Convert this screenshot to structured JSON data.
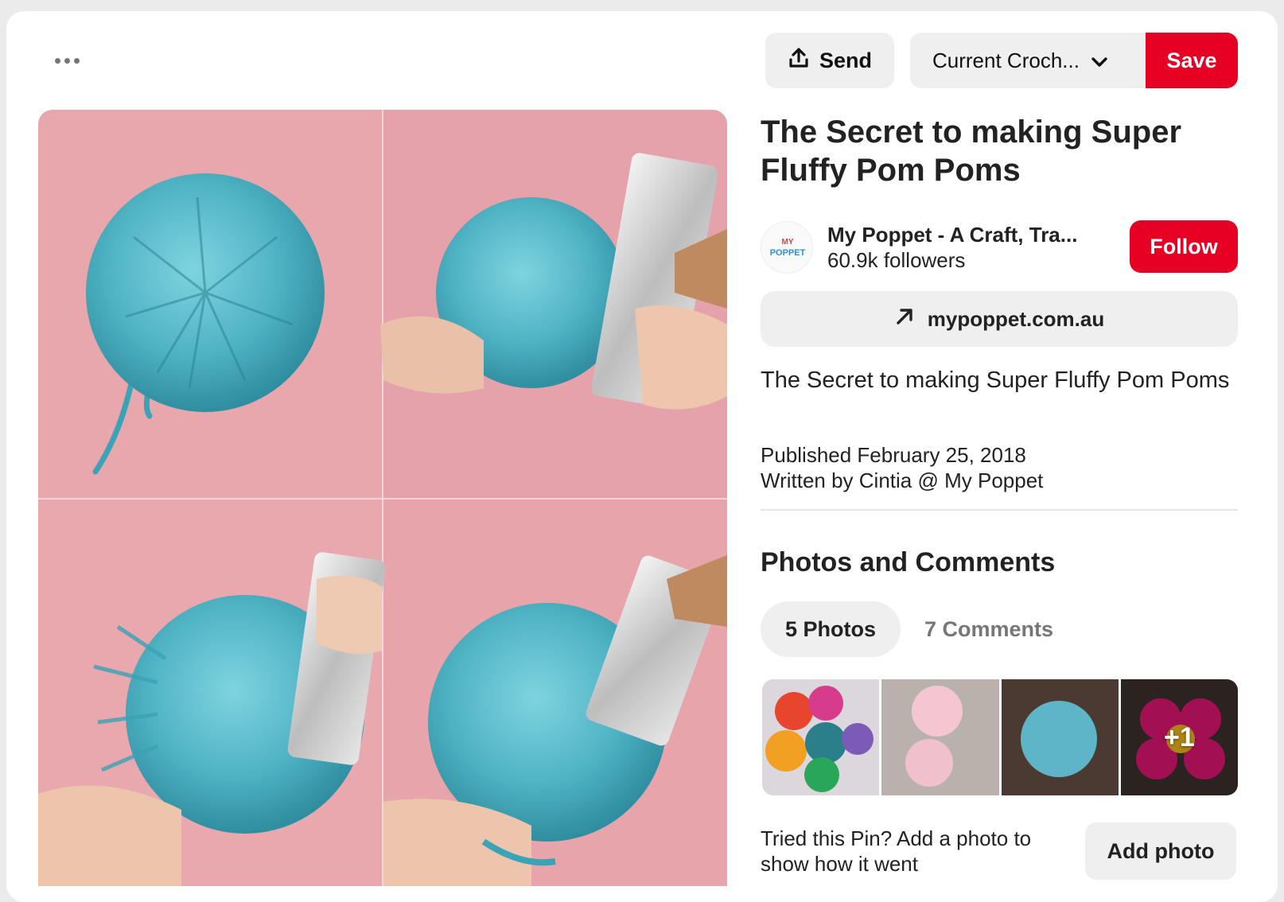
{
  "toolbar": {
    "more_icon": "ellipsis-icon",
    "send_label": "Send",
    "send_icon": "share-upload-icon",
    "board_name": "Current Croch...",
    "board_icon": "chevron-down-icon",
    "save_label": "Save"
  },
  "pin": {
    "title": "The Secret to making Super Fluffy Pom Poms",
    "image_alt": "4-panel photo of blue yarn pom pom being brushed with a slicker brush on pink background",
    "creator": {
      "name": "My Poppet - A Craft, Tra...",
      "followers": "60.9k followers",
      "avatar_text": "MY POPPET",
      "follow_label": "Follow"
    },
    "link": {
      "icon": "arrow-up-right-icon",
      "label": "mypoppet.com.au"
    },
    "description": "The Secret to making Super Fluffy Pom Poms",
    "published": "Published February 25, 2018",
    "author": "Written by Cintia @ My Poppet"
  },
  "comments_section": {
    "title": "Photos and Comments",
    "tabs": [
      {
        "label": "5 Photos",
        "active": true
      },
      {
        "label": "7 Comments",
        "active": false
      }
    ],
    "thumbnails": [
      {
        "desc": "multicolor pom poms"
      },
      {
        "desc": "pink pom poms"
      },
      {
        "desc": "blue pom pom"
      },
      {
        "desc": "pink flower pom pom",
        "overlay": "+1"
      }
    ],
    "tried_prompt": "Tried this Pin? Add a photo to show how it went",
    "add_photo_label": "Add photo"
  },
  "colors": {
    "brand_red": "#e60023",
    "button_gray": "#efefef",
    "pom_blue": "#4fb3c4",
    "pink_bg": "#e7a3ac"
  }
}
